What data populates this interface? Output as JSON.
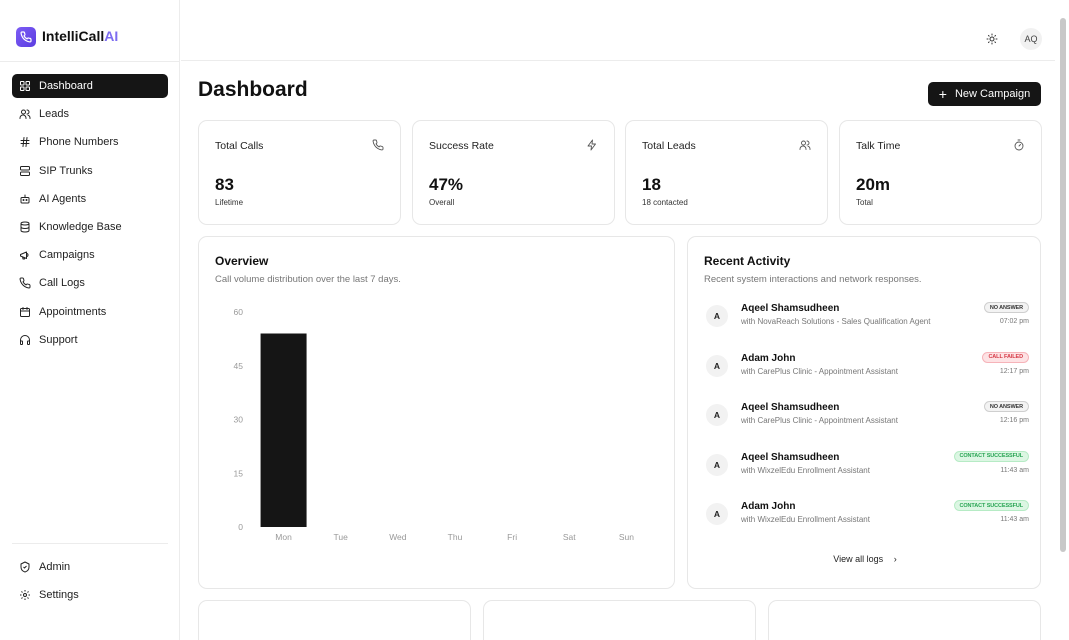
{
  "brand": {
    "name": "IntelliCall",
    "suffix": "AI"
  },
  "nav": {
    "items": [
      {
        "label": "Dashboard",
        "icon": "grid-icon",
        "active": true
      },
      {
        "label": "Leads",
        "icon": "users-icon"
      },
      {
        "label": "Phone Numbers",
        "icon": "hash-icon"
      },
      {
        "label": "SIP Trunks",
        "icon": "server-icon"
      },
      {
        "label": "AI Agents",
        "icon": "bot-icon"
      },
      {
        "label": "Knowledge Base",
        "icon": "database-icon"
      },
      {
        "label": "Campaigns",
        "icon": "megaphone-icon"
      },
      {
        "label": "Call Logs",
        "icon": "phone-icon"
      },
      {
        "label": "Appointments",
        "icon": "calendar-icon"
      },
      {
        "label": "Support",
        "icon": "headphones-icon"
      }
    ],
    "bottom": [
      {
        "label": "Admin",
        "icon": "shield-icon"
      },
      {
        "label": "Settings",
        "icon": "gear-icon"
      }
    ]
  },
  "header": {
    "user_initials": "AQ",
    "theme_icon": "sun-icon"
  },
  "page": {
    "title": "Dashboard",
    "new_campaign_label": "New Campaign"
  },
  "stats": [
    {
      "label": "Total Calls",
      "value": "83",
      "sub": "Lifetime",
      "icon": "phone-icon"
    },
    {
      "label": "Success Rate",
      "value": "47%",
      "sub": "Overall",
      "icon": "zap-icon"
    },
    {
      "label": "Total Leads",
      "value": "18",
      "sub": "18 contacted",
      "icon": "users-icon"
    },
    {
      "label": "Talk Time",
      "value": "20m",
      "sub": "Total",
      "icon": "timer-icon"
    }
  ],
  "overview": {
    "title": "Overview",
    "subtitle": "Call volume distribution over the last 7 days."
  },
  "chart_data": {
    "type": "bar",
    "categories": [
      "Mon",
      "Tue",
      "Wed",
      "Thu",
      "Fri",
      "Sat",
      "Sun"
    ],
    "values": [
      54,
      0,
      0,
      0,
      0,
      0,
      0
    ],
    "yticks": [
      0,
      15,
      30,
      45,
      60
    ],
    "ylim": [
      0,
      60
    ],
    "grid": false,
    "bar_color": "#151515"
  },
  "activity": {
    "title": "Recent Activity",
    "subtitle": "Recent system interactions and network responses.",
    "items": [
      {
        "initial": "A",
        "name": "Aqeel Shamsudheen",
        "desc": "with NovaReach Solutions - Sales Qualification Agent",
        "badge": "NO ANSWER",
        "status": "gray",
        "time": "07:02 pm"
      },
      {
        "initial": "A",
        "name": "Adam John",
        "desc": "with CarePlus Clinic - Appointment Assistant",
        "badge": "CALL FAILED",
        "status": "red",
        "time": "12:17 pm"
      },
      {
        "initial": "A",
        "name": "Aqeel Shamsudheen",
        "desc": "with CarePlus Clinic - Appointment Assistant",
        "badge": "NO ANSWER",
        "status": "gray",
        "time": "12:16 pm"
      },
      {
        "initial": "A",
        "name": "Aqeel Shamsudheen",
        "desc": "with WixzelEdu Enrollment Assistant",
        "badge": "CONTACT SUCCESSFUL",
        "status": "green",
        "time": "11:43 am"
      },
      {
        "initial": "A",
        "name": "Adam John",
        "desc": "with WixzelEdu Enrollment Assistant",
        "badge": "CONTACT SUCCESSFUL",
        "status": "green",
        "time": "11:43 am"
      }
    ],
    "view_all_label": "View all logs"
  }
}
